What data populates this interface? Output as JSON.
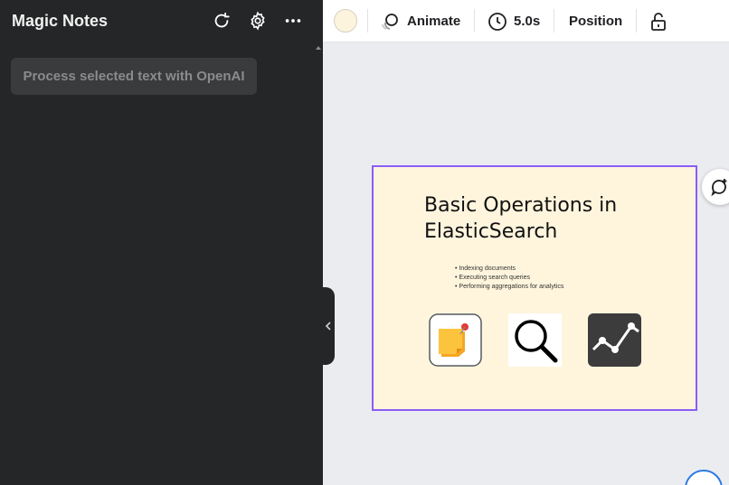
{
  "panel": {
    "title": "Magic Notes",
    "process_button": "Process selected text with OpenAI",
    "icons": [
      "refresh-icon",
      "gear-icon",
      "more-icon"
    ]
  },
  "toolbar": {
    "color": "#fdf4de",
    "animate_label": "Animate",
    "duration_label": "5.0s",
    "position_label": "Position"
  },
  "slide": {
    "title": "Basic Operations in ElasticSearch",
    "bullets": [
      "Indexing documents",
      "Executing search queries",
      "Performing aggregations for analytics"
    ],
    "icons": [
      "sticky-note-icon",
      "magnifier-icon",
      "analytics-chart-icon"
    ]
  },
  "colors": {
    "panel_bg": "#252627",
    "selection": "#8b5cf6",
    "slide_bg": "#fff5dd"
  }
}
